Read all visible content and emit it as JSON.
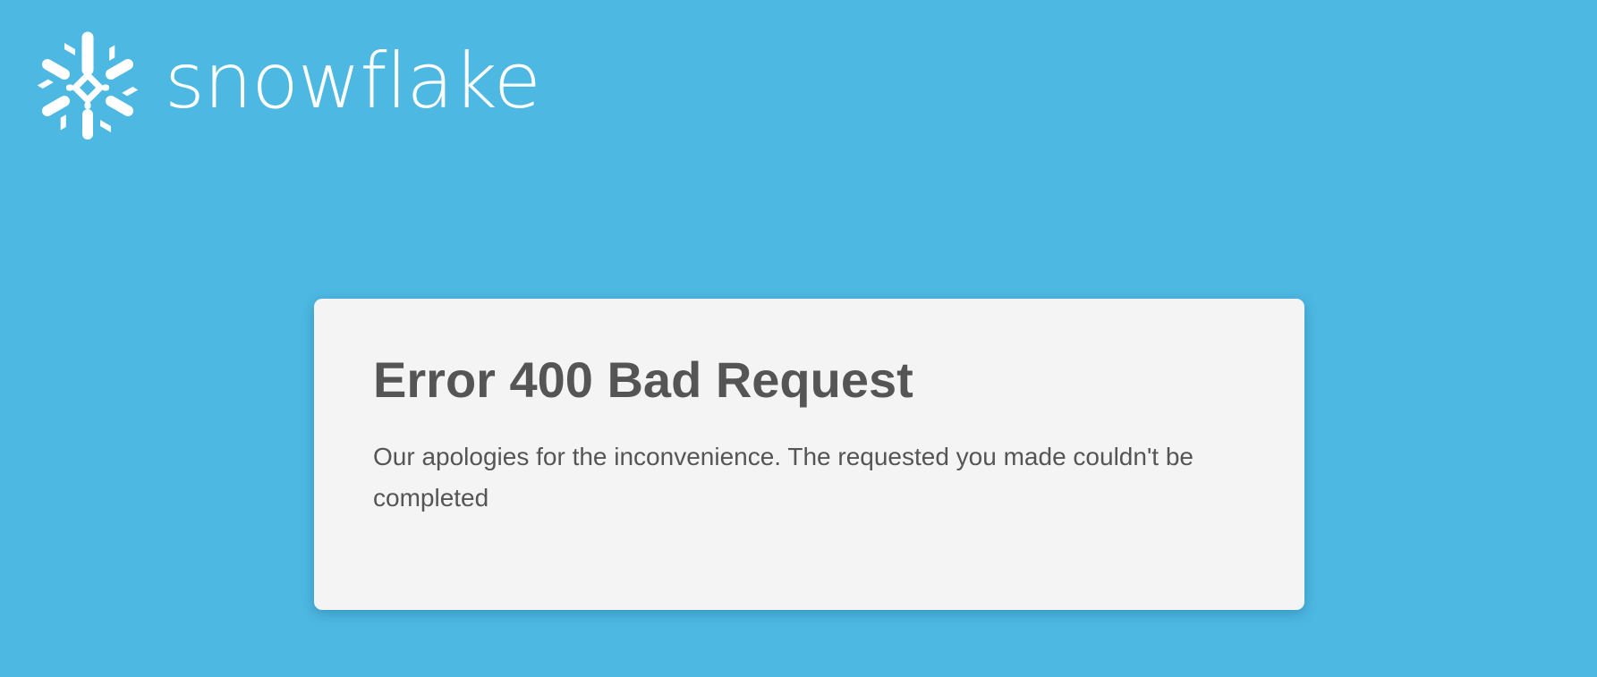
{
  "brand": {
    "name": "snowflake",
    "logo_icon": "snowflake-logo-icon",
    "color": "#ffffff"
  },
  "background_color": "#4db8e2",
  "error": {
    "title": "Error 400 Bad Request",
    "message": "Our apologies for the inconvenience. The requested you made couldn't be completed"
  },
  "card_color": "#f4f4f4",
  "text_color": "#555555"
}
